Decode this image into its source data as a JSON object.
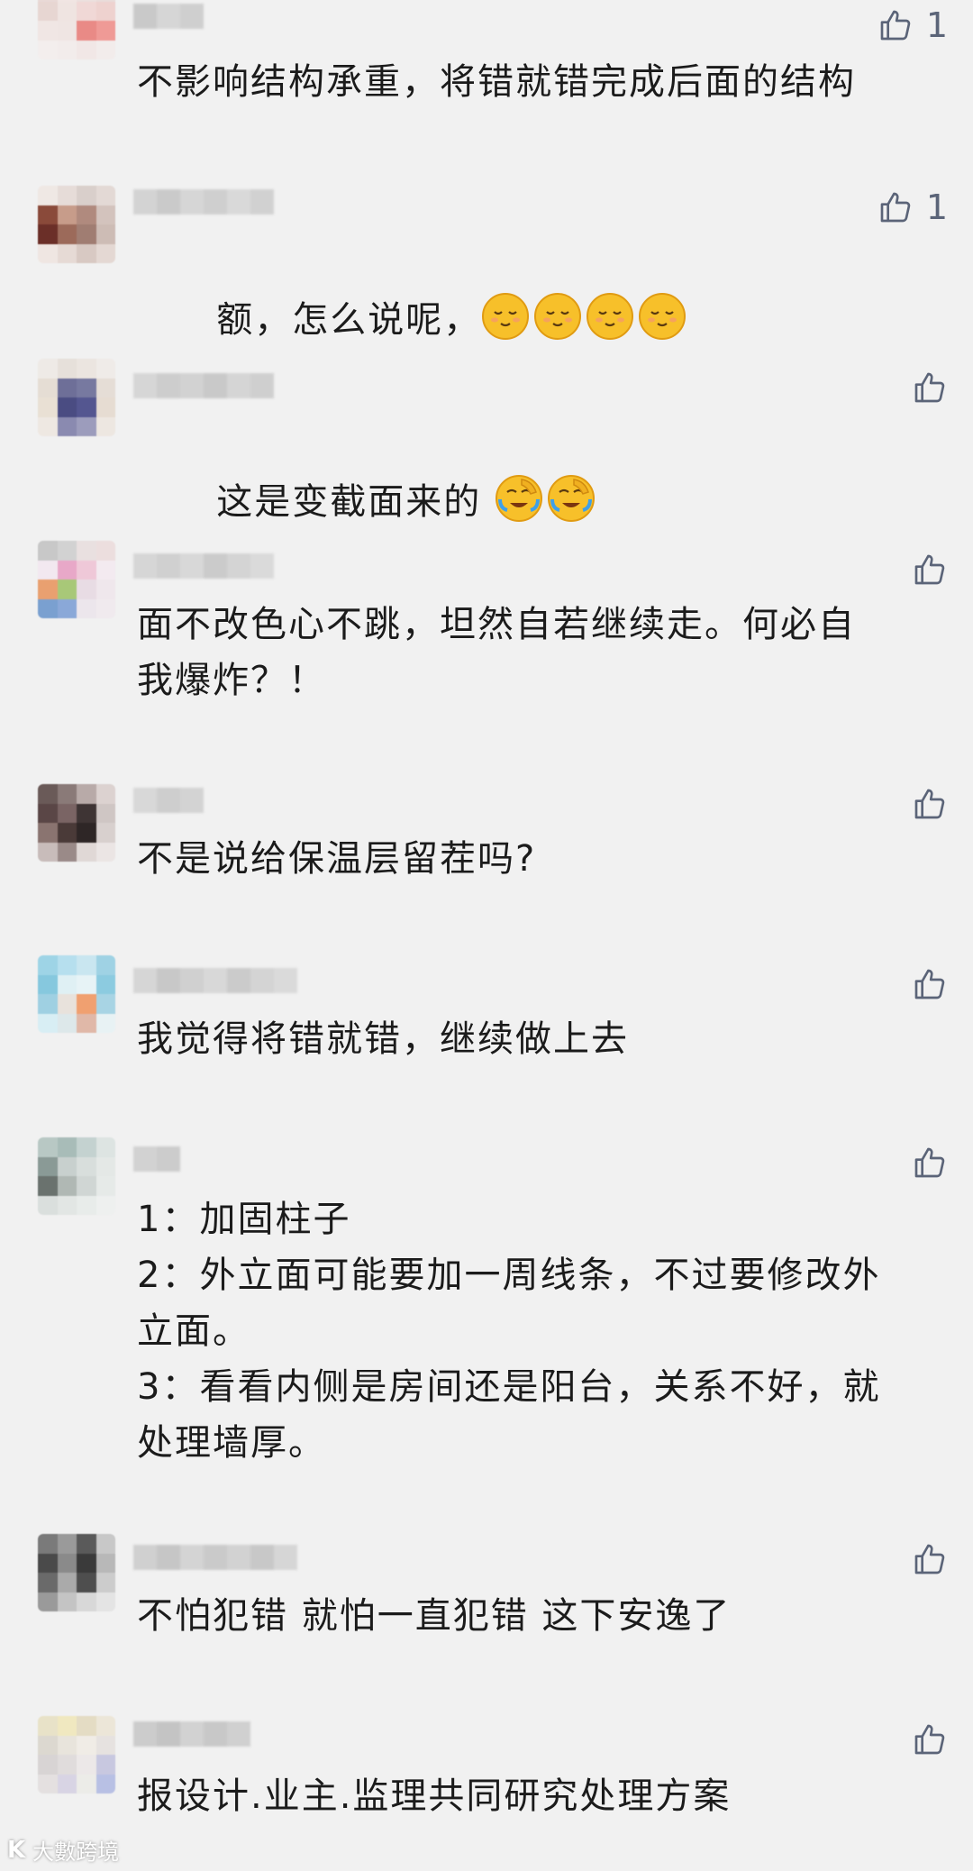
{
  "comments": [
    {
      "text": "不影响结构承重，将错就错完成后面的结构",
      "likes": "1"
    },
    {
      "text": "额，怎么说呢，",
      "likes": "1",
      "emoji": [
        "smiling-face-emoji",
        "smiling-face-emoji",
        "smiling-face-emoji",
        "smiling-face-emoji"
      ]
    },
    {
      "text": "这是变截面来的",
      "likes": "",
      "emoji": [
        "face-palm-tears-emoji",
        "face-palm-tears-emoji"
      ]
    },
    {
      "text": "面不改色心不跳，坦然自若继续走。何必自\n我爆炸？！",
      "likes": ""
    },
    {
      "text": "不是说给保温层留茬吗?",
      "likes": ""
    },
    {
      "text": "我觉得将错就错，继续做上去",
      "likes": ""
    },
    {
      "text": "1：加固柱子\n2：外立面可能要加一周线条，不过要修改外\n立面。\n3：看看内侧是房间还是阳台，关系不好，就\n处理墙厚。",
      "likes": ""
    },
    {
      "text": "不怕犯错 就怕一直犯错 这下安逸了",
      "likes": ""
    },
    {
      "text": "报设计.业主.监理共同研究处理方案",
      "likes": ""
    }
  ],
  "watermark": {
    "logo": "K",
    "text": "大數跨境"
  },
  "colors": {
    "background": "#f1f1f1",
    "text": "#1b1b1b",
    "like_icon": "#5b6478",
    "emoji_yellow": "#f7c02a"
  }
}
